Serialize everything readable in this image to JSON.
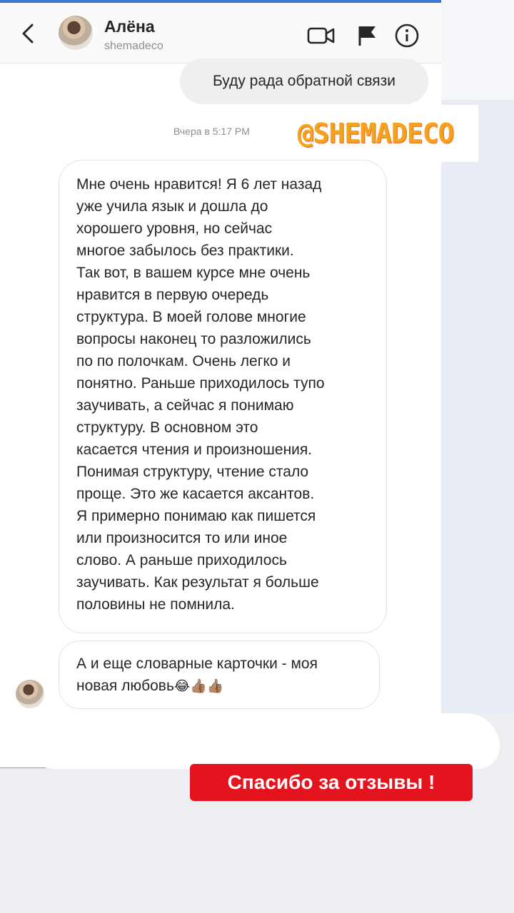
{
  "header": {
    "name": "Алёна",
    "username": "shemadeco",
    "icons": [
      "back-icon",
      "video-call-icon",
      "flag-icon",
      "info-icon"
    ]
  },
  "messages": {
    "sent_text": "Буду рада обратной связи",
    "timestamp": "Вчера в 5:17 PM",
    "received_1": "Мне очень нравится! Я 6 лет назад\nуже учила язык и дошла до\nхорошего уровня, но сейчас\nмногое забылось без практики.\nТак вот, в вашем курсе мне очень\nнравится в первую очередь\nструктура. В моей голове многие\nвопросы наконец то разложились\nпо по полочкам. Очень легко и\nпонятно. Раньше приходилось тупо\nзаучивать, а сейчас я понимаю\nструктуру. В основном это\nкасается чтения и произношения.\nПонимая структуру,  чтение стало\nпроще. Это же касается аксантов.\nЯ примерно понимаю как пишется\nили произносится то или иное\nслово. А раньше приходилось\nзаучивать. Как результат я больше\nполовины не помнила.",
    "received_2_line1": "А и еще словарные карточки - моя",
    "received_2_line2": "новая любовь",
    "received_2_emoji": "😂👍🏽👍🏽"
  },
  "overlay": {
    "tag": "@SHEMADECO",
    "tag_color": "#f7a21b",
    "thanks": "Спасибо за отзывы !",
    "thanks_color": "#e4141f"
  }
}
